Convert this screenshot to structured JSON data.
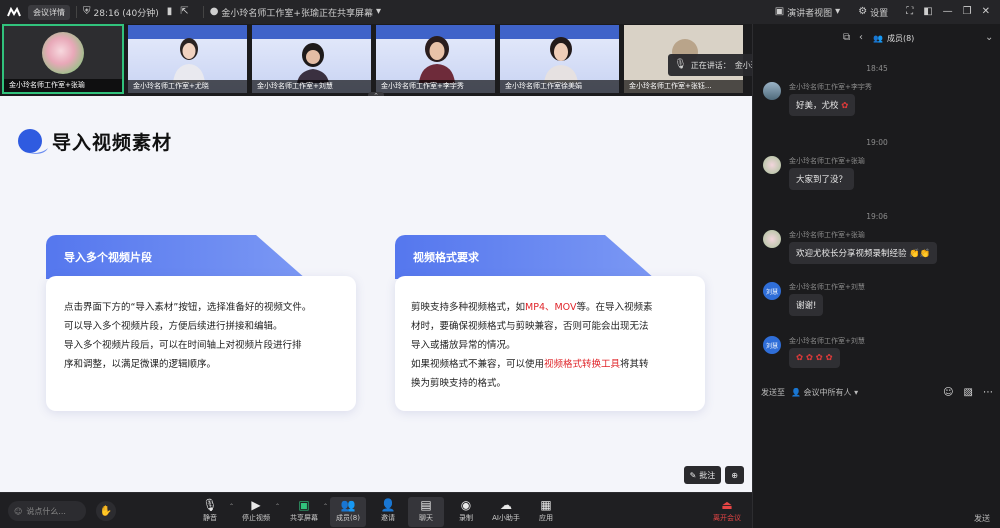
{
  "topbar": {
    "details_label": "会议详情",
    "timer": "28:16 (40分钟)",
    "share_status": "金小玲名师工作室+张瑜正在共享屏幕",
    "view_label": "演讲者视图",
    "settings_label": "设置"
  },
  "video_strip": {
    "tiles": [
      {
        "name": "金小玲名师工作室+张瑜"
      },
      {
        "name": "金小玲名师工作室+尤晓"
      },
      {
        "name": "金小玲名师工作室+刘慧"
      },
      {
        "name": "金小玲名师工作室+李宇秀"
      },
      {
        "name": "金小玲名师工作室徐美娟"
      },
      {
        "name": "金小玲名师工作室+张钰..."
      }
    ],
    "speaking_label": "正在讲话：",
    "speaking_name": "金小玲名师工作室+..."
  },
  "slide": {
    "title": "导入视频素材",
    "card1": {
      "heading": "导入多个视频片段",
      "lines": [
        "点击界面下方的“导入素材”按钮，选择准备好的视频文件。",
        "可以导入多个视频片段，方便后续进行拼接和编辑。",
        "导入多个视频片段后，可以在时间轴上对视频片段进行排",
        "序和调整，以满足微课的逻辑顺序。"
      ]
    },
    "card2": {
      "heading": "视频格式要求",
      "line1_a": "剪映支持多种视频格式，如",
      "line1_hl": "MP4、MOV",
      "line1_b": "等。在导入视频素",
      "line2": "材时，要确保视频格式与剪映兼容，否则可能会出现无法",
      "line3": "导入或播放异常的情况。",
      "line4_a": "如果视频格式不兼容，可以使用",
      "line4_hl": "视频格式转换工具",
      "line4_b": "将其转",
      "line5": "换为剪映支持的格式。"
    },
    "annotate_label": "批注"
  },
  "bottombar": {
    "chat_placeholder": "说点什么...",
    "buttons": [
      {
        "label": "静音",
        "icon": "mic-icon"
      },
      {
        "label": "停止视频",
        "icon": "camera-icon"
      },
      {
        "label": "共享屏幕",
        "icon": "share-screen-icon"
      },
      {
        "label": "成员(8)",
        "icon": "members-icon"
      },
      {
        "label": "邀请",
        "icon": "invite-icon"
      },
      {
        "label": "聊天",
        "icon": "chat-icon"
      },
      {
        "label": "录制",
        "icon": "record-icon"
      },
      {
        "label": "AI小助手",
        "icon": "ai-icon"
      },
      {
        "label": "应用",
        "icon": "apps-icon"
      }
    ],
    "leave_label": "离开会议"
  },
  "panel": {
    "members_tab": "成员(8)",
    "messages": [
      {
        "time": "18:45",
        "sender": "金小玲名师工作室+李宇秀",
        "text": "好美，尤校"
      },
      {
        "time": "19:00",
        "sender": "金小玲名师工作室+张瑜",
        "text": "大家到了没？"
      },
      {
        "time": "19:06",
        "sender": "金小玲名师工作室+张瑜",
        "text": "欢迎尤校长分享视频录制经验"
      },
      {
        "time": "",
        "sender": "金小玲名师工作室+刘慧",
        "text": "谢谢!",
        "avatar": "刘慧"
      },
      {
        "time": "",
        "sender": "金小玲名师工作室+刘慧",
        "text": "",
        "avatar": "刘慧"
      }
    ],
    "send_to_label": "发送至",
    "send_to_target": "会议中所有人",
    "send_button": "发送"
  }
}
